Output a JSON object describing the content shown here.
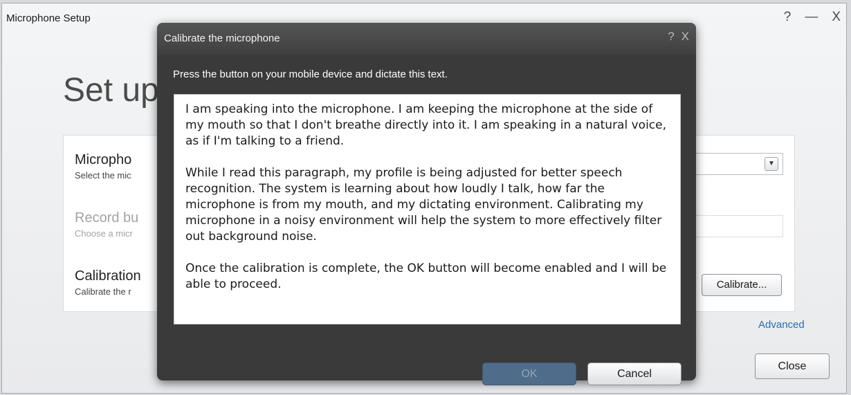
{
  "main_window": {
    "title": "Microphone Setup",
    "help_label": "?",
    "minimize_label": "—",
    "close_label": "X",
    "heading": "Set up",
    "rows": [
      {
        "title": "Micropho",
        "subtitle": "Select the mic"
      },
      {
        "title": "Record bu",
        "subtitle": "Choose a micr"
      },
      {
        "title": "Calibration",
        "subtitle": "Calibrate the r"
      }
    ],
    "calibrate_button": "Calibrate...",
    "advanced_link": "Advanced",
    "close_button": "Close",
    "dropdown_arrow": "▼"
  },
  "dialog": {
    "title": "Calibrate the microphone",
    "help_label": "?",
    "close_label": "X",
    "instruction": "Press the button on your mobile device and dictate this text.",
    "paragraphs": [
      "I am speaking into the microphone. I am keeping the microphone at the side of my mouth so that I don't breathe directly into it. I am speaking in a natural voice, as if I'm talking to a friend.",
      "While I read this paragraph, my profile is being adjusted for better speech recognition. The system is learning about how loudly I talk, how far the microphone is from my mouth, and my dictating environment. Calibrating my microphone in a noisy environment will help the system to more effectively filter out background noise.",
      "Once the calibration is complete, the OK button will become enabled and I will be able to proceed."
    ],
    "ok_button": "OK",
    "cancel_button": "Cancel"
  }
}
